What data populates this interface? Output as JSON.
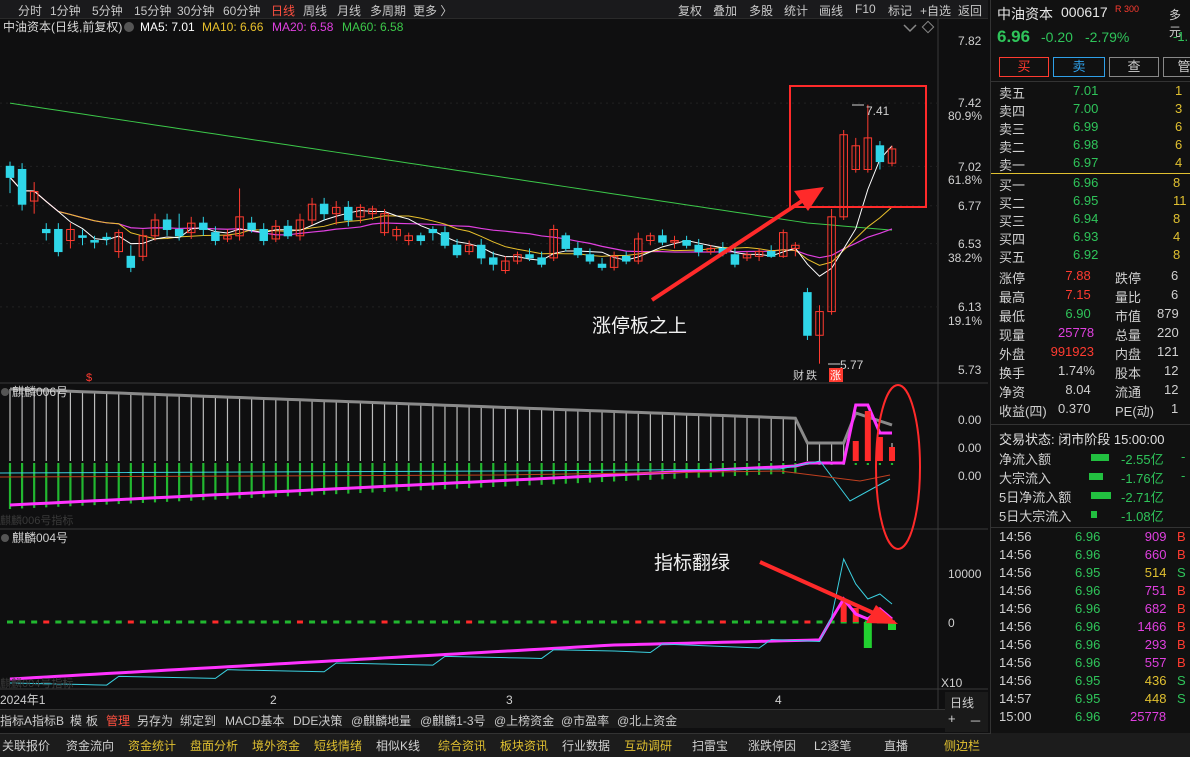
{
  "toolbar": {
    "periods": [
      "分时",
      "1分钟",
      "5分钟",
      "15分钟",
      "30分钟",
      "60分钟",
      "日线",
      "周线",
      "月线",
      "多周期",
      "更多 〉"
    ],
    "active_period": "日线",
    "right": [
      "复权",
      "叠加",
      "多股",
      "统计",
      "画线",
      "F10",
      "标记",
      "+自选",
      "返回"
    ]
  },
  "main_chart": {
    "title": "中油资本(日线,前复权)",
    "ma5": "MA5: 7.01",
    "ma10": "MA10: 6.66",
    "ma20": "MA20: 6.58",
    "ma60": "MA60: 6.58",
    "price_ticks": [
      "7.82",
      "7.42",
      "7.02",
      "6.77",
      "6.53",
      "6.13",
      "5.73"
    ],
    "pct_ticks": [
      "80.9%",
      "61.8%",
      "38.2%",
      "19.1%"
    ],
    "high_label": "7.41",
    "low_label": "5.77",
    "event_marks": [
      "财",
      "跌",
      "涨"
    ],
    "annotation": "涨停板之上",
    "candles": [
      {
        "o": 7.02,
        "c": 6.95,
        "h": 7.05,
        "l": 6.85
      },
      {
        "o": 7.0,
        "c": 6.78,
        "h": 7.04,
        "l": 6.74
      },
      {
        "o": 6.8,
        "c": 6.86,
        "h": 6.92,
        "l": 6.72
      },
      {
        "o": 6.62,
        "c": 6.6,
        "h": 6.66,
        "l": 6.55
      },
      {
        "o": 6.62,
        "c": 6.48,
        "h": 6.66,
        "l": 6.45
      },
      {
        "o": 6.55,
        "c": 6.62,
        "h": 6.66,
        "l": 6.5
      },
      {
        "o": 6.58,
        "c": 6.57,
        "h": 6.62,
        "l": 6.52
      },
      {
        "o": 6.55,
        "c": 6.54,
        "h": 6.58,
        "l": 6.5
      },
      {
        "o": 6.57,
        "c": 6.56,
        "h": 6.6,
        "l": 6.52
      },
      {
        "o": 6.48,
        "c": 6.6,
        "h": 6.62,
        "l": 6.44
      },
      {
        "o": 6.45,
        "c": 6.38,
        "h": 6.52,
        "l": 6.35
      },
      {
        "o": 6.45,
        "c": 6.58,
        "h": 6.62,
        "l": 6.42
      },
      {
        "o": 6.58,
        "c": 6.68,
        "h": 6.72,
        "l": 6.55
      },
      {
        "o": 6.68,
        "c": 6.62,
        "h": 6.72,
        "l": 6.58
      },
      {
        "o": 6.62,
        "c": 6.58,
        "h": 6.72,
        "l": 6.55
      },
      {
        "o": 6.6,
        "c": 6.66,
        "h": 6.7,
        "l": 6.56
      },
      {
        "o": 6.66,
        "c": 6.62,
        "h": 6.7,
        "l": 6.58
      },
      {
        "o": 6.6,
        "c": 6.55,
        "h": 6.64,
        "l": 6.52
      },
      {
        "o": 6.56,
        "c": 6.58,
        "h": 6.62,
        "l": 6.54
      },
      {
        "o": 6.58,
        "c": 6.7,
        "h": 6.88,
        "l": 6.55
      },
      {
        "o": 6.66,
        "c": 6.62,
        "h": 6.7,
        "l": 6.6
      },
      {
        "o": 6.62,
        "c": 6.55,
        "h": 6.66,
        "l": 6.52
      },
      {
        "o": 6.56,
        "c": 6.64,
        "h": 6.68,
        "l": 6.54
      },
      {
        "o": 6.64,
        "c": 6.58,
        "h": 6.68,
        "l": 6.56
      },
      {
        "o": 6.58,
        "c": 6.68,
        "h": 6.72,
        "l": 6.55
      },
      {
        "o": 6.68,
        "c": 6.78,
        "h": 6.82,
        "l": 6.65
      },
      {
        "o": 6.78,
        "c": 6.72,
        "h": 6.82,
        "l": 6.68
      },
      {
        "o": 6.72,
        "c": 6.76,
        "h": 6.8,
        "l": 6.65
      },
      {
        "o": 6.76,
        "c": 6.68,
        "h": 6.8,
        "l": 6.64
      },
      {
        "o": 6.7,
        "c": 6.76,
        "h": 6.78,
        "l": 6.66
      },
      {
        "o": 6.72,
        "c": 6.75,
        "h": 6.77,
        "l": 6.68
      },
      {
        "o": 6.6,
        "c": 6.72,
        "h": 6.75,
        "l": 6.58
      },
      {
        "o": 6.58,
        "c": 6.62,
        "h": 6.64,
        "l": 6.55
      },
      {
        "o": 6.55,
        "c": 6.58,
        "h": 6.6,
        "l": 6.52
      },
      {
        "o": 6.58,
        "c": 6.55,
        "h": 6.6,
        "l": 6.52
      },
      {
        "o": 6.62,
        "c": 6.6,
        "h": 6.64,
        "l": 6.55
      },
      {
        "o": 6.6,
        "c": 6.52,
        "h": 6.64,
        "l": 6.5
      },
      {
        "o": 6.52,
        "c": 6.46,
        "h": 6.56,
        "l": 6.44
      },
      {
        "o": 6.48,
        "c": 6.52,
        "h": 6.55,
        "l": 6.46
      },
      {
        "o": 6.52,
        "c": 6.44,
        "h": 6.56,
        "l": 6.4
      },
      {
        "o": 6.44,
        "c": 6.4,
        "h": 6.48,
        "l": 6.36
      },
      {
        "o": 6.36,
        "c": 6.42,
        "h": 6.45,
        "l": 6.34
      },
      {
        "o": 6.42,
        "c": 6.46,
        "h": 6.48,
        "l": 6.4
      },
      {
        "o": 6.46,
        "c": 6.44,
        "h": 6.5,
        "l": 6.42
      },
      {
        "o": 6.44,
        "c": 6.4,
        "h": 6.48,
        "l": 6.38
      },
      {
        "o": 6.44,
        "c": 6.62,
        "h": 6.65,
        "l": 6.42
      },
      {
        "o": 6.58,
        "c": 6.5,
        "h": 6.6,
        "l": 6.48
      },
      {
        "o": 6.5,
        "c": 6.46,
        "h": 6.54,
        "l": 6.44
      },
      {
        "o": 6.46,
        "c": 6.42,
        "h": 6.5,
        "l": 6.4
      },
      {
        "o": 6.4,
        "c": 6.38,
        "h": 6.44,
        "l": 6.36
      },
      {
        "o": 6.38,
        "c": 6.45,
        "h": 6.48,
        "l": 6.36
      },
      {
        "o": 6.45,
        "c": 6.42,
        "h": 6.48,
        "l": 6.4
      },
      {
        "o": 6.42,
        "c": 6.56,
        "h": 6.6,
        "l": 6.4
      },
      {
        "o": 6.55,
        "c": 6.58,
        "h": 6.6,
        "l": 6.52
      },
      {
        "o": 6.58,
        "c": 6.54,
        "h": 6.62,
        "l": 6.52
      },
      {
        "o": 6.54,
        "c": 6.55,
        "h": 6.58,
        "l": 6.5
      },
      {
        "o": 6.55,
        "c": 6.52,
        "h": 6.58,
        "l": 6.5
      },
      {
        "o": 6.52,
        "c": 6.48,
        "h": 6.56,
        "l": 6.45
      },
      {
        "o": 6.48,
        "c": 6.5,
        "h": 6.52,
        "l": 6.46
      },
      {
        "o": 6.5,
        "c": 6.47,
        "h": 6.54,
        "l": 6.45
      },
      {
        "o": 6.46,
        "c": 6.4,
        "h": 6.5,
        "l": 6.38
      },
      {
        "o": 6.44,
        "c": 6.46,
        "h": 6.48,
        "l": 6.42
      },
      {
        "o": 6.45,
        "c": 6.48,
        "h": 6.5,
        "l": 6.42
      },
      {
        "o": 6.48,
        "c": 6.45,
        "h": 6.52,
        "l": 6.44
      },
      {
        "o": 6.45,
        "c": 6.6,
        "h": 6.62,
        "l": 6.44
      },
      {
        "o": 6.5,
        "c": 6.52,
        "h": 6.54,
        "l": 6.45
      },
      {
        "o": 6.22,
        "c": 5.95,
        "h": 6.25,
        "l": 5.92
      },
      {
        "o": 5.95,
        "c": 6.1,
        "h": 6.14,
        "l": 5.77
      },
      {
        "o": 6.1,
        "c": 6.7,
        "h": 6.75,
        "l": 6.08
      },
      {
        "o": 6.7,
        "c": 7.22,
        "h": 7.25,
        "l": 6.68
      },
      {
        "o": 7.0,
        "c": 7.15,
        "h": 7.2,
        "l": 6.98
      },
      {
        "o": 7.0,
        "c": 7.2,
        "h": 7.41,
        "l": 6.98
      },
      {
        "o": 7.15,
        "c": 7.05,
        "h": 7.18,
        "l": 7.0
      },
      {
        "o": 7.04,
        "c": 7.13,
        "h": 7.15,
        "l": 7.02
      }
    ]
  },
  "ind1": {
    "title": "麒麟006号",
    "ticks": [
      "0.00",
      "0.00",
      "0.00"
    ],
    "watermark": "麒麟006号指标"
  },
  "ind2": {
    "title": "麒麟004号",
    "ticks": [
      "10000",
      "0"
    ],
    "watermark": "麒麟004号指标",
    "annotation": "指标翻绿"
  },
  "x_axis": {
    "labels": [
      "2024年1",
      "2",
      "3",
      "4"
    ],
    "scale": "X10"
  },
  "bottom_tabs1": [
    "指标A",
    "指标B",
    "模",
    "板",
    "管理",
    "另存为",
    "绑定到",
    "MACD基本",
    "DDE决策",
    "@麒麟地量",
    "@麒麟1-3号",
    "@上榜资金",
    "@市盈率",
    "@北上资金"
  ],
  "bottom_tabs1_right": [
    "日线",
    "+",
    "－"
  ],
  "bottom_tabs2": [
    "关联报价",
    "资金流向",
    "资金统计",
    "盘面分析",
    "境外资金",
    "短线情绪",
    "相似K线",
    "综合资讯",
    "板块资讯",
    "行业数据",
    "互动调研",
    "扫雷宝",
    "涨跌停因",
    "L2逐笔",
    "直播",
    "侧边栏"
  ],
  "quote": {
    "name": "中油资本",
    "code": "000617",
    "badge": "R 300",
    "more": "多元",
    "price": "6.96",
    "change": "-0.20",
    "pct": "-2.79%",
    "pct2": "-1.",
    "buttons": [
      "买",
      "卖",
      "查",
      "管"
    ],
    "sells": [
      [
        "卖五",
        "7.01",
        "1"
      ],
      [
        "卖四",
        "7.00",
        "3"
      ],
      [
        "卖三",
        "6.99",
        "6"
      ],
      [
        "卖二",
        "6.98",
        "6"
      ],
      [
        "卖一",
        "6.97",
        "4"
      ]
    ],
    "buys": [
      [
        "买一",
        "6.96",
        "8"
      ],
      [
        "买二",
        "6.95",
        "11"
      ],
      [
        "买三",
        "6.94",
        "8"
      ],
      [
        "买四",
        "6.93",
        "4"
      ],
      [
        "买五",
        "6.92",
        "8"
      ]
    ],
    "stats": [
      [
        "涨停",
        "7.88",
        "跌停",
        "6"
      ],
      [
        "最高",
        "7.15",
        "量比",
        "6"
      ],
      [
        "最低",
        "6.90",
        "市值",
        "879"
      ],
      [
        "现量",
        "25778",
        "总量",
        "220"
      ],
      [
        "外盘",
        "991923",
        "内盘",
        "121"
      ],
      [
        "换手",
        "1.74%",
        "股本",
        "12"
      ],
      [
        "净资",
        "8.04",
        "流通",
        "12"
      ],
      [
        "收益(四)",
        "0.370",
        "PE(动)",
        "1"
      ]
    ],
    "trade_status": "交易状态: 闭市阶段 15:00:00",
    "flows": [
      [
        "净流入额",
        "-2.55亿",
        "-"
      ],
      [
        "大宗流入",
        "-1.76亿",
        "-"
      ],
      [
        "5日净流入额",
        "-2.71亿",
        ""
      ],
      [
        "5日大宗流入",
        "-1.08亿",
        ""
      ]
    ],
    "ticks": [
      [
        "14:56",
        "6.96",
        "909",
        "B"
      ],
      [
        "14:56",
        "6.96",
        "660",
        "B"
      ],
      [
        "14:56",
        "6.95",
        "514",
        "S"
      ],
      [
        "14:56",
        "6.96",
        "751",
        "B"
      ],
      [
        "14:56",
        "6.96",
        "682",
        "B"
      ],
      [
        "14:56",
        "6.96",
        "1466",
        "B"
      ],
      [
        "14:56",
        "6.96",
        "293",
        "B"
      ],
      [
        "14:56",
        "6.96",
        "557",
        "B"
      ],
      [
        "14:56",
        "6.95",
        "436",
        "S"
      ],
      [
        "14:57",
        "6.95",
        "448",
        "S"
      ],
      [
        "15:00",
        "6.96",
        "25778",
        ""
      ]
    ],
    "bottom_tabs": [
      "笔",
      "价",
      "细",
      "势",
      "联",
      "值",
      "主"
    ]
  },
  "colors": {
    "up": "#ff3b30",
    "down": "#2fd6e8",
    "ma5": "#ffffff",
    "ma10": "#e8c02c",
    "ma20": "#e040e0",
    "ma60": "#3cc84a",
    "annot_red": "#ff2a2a"
  }
}
